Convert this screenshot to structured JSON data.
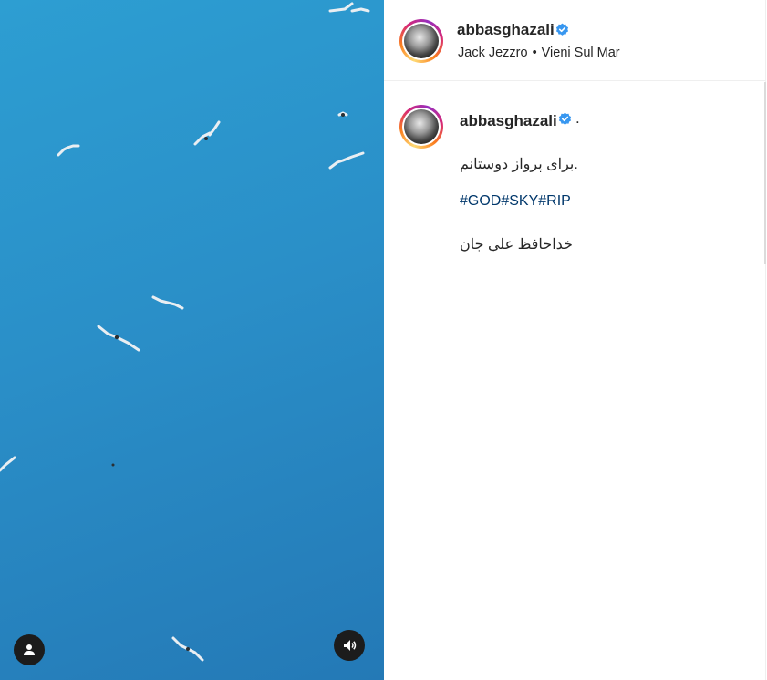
{
  "post": {
    "username": "abbasghazali",
    "verified": true,
    "music_artist": "Jack Jezzro",
    "separator": "•",
    "music_title": "Vieni Sul Mar"
  },
  "caption": {
    "username": "abbasghazali",
    "trailing": ".",
    "line1": "برای پرواز دوستانم.",
    "hashtags": "#GOD#SKY#RIP",
    "line3": "خداحافظ علي جان"
  },
  "media": {
    "type": "video",
    "icons": [
      "user-tag-icon",
      "sound-icon"
    ]
  },
  "colors": {
    "sky": "#2a8fc8",
    "verified_blue": "#3897f0",
    "hashtag": "#00376b"
  }
}
